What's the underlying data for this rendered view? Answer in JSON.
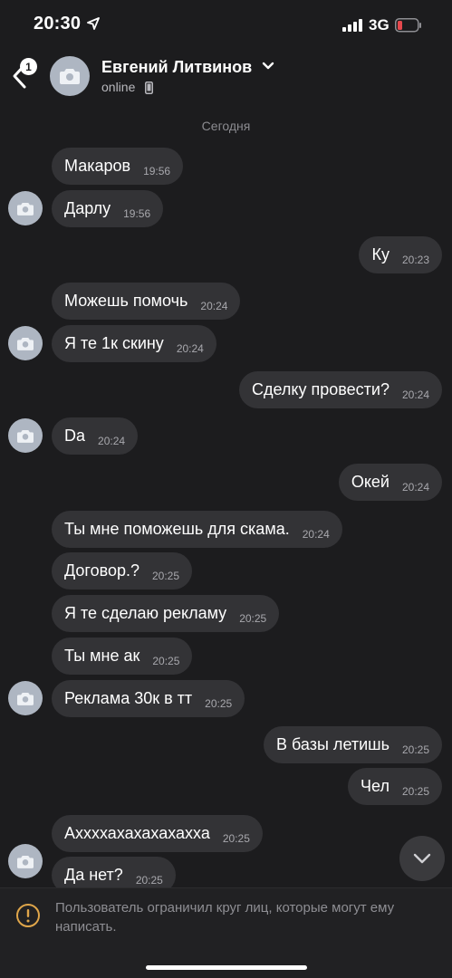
{
  "status_bar": {
    "time": "20:30",
    "network": "3G"
  },
  "header": {
    "back_badge": "1",
    "contact_name": "Евгений Литвинов",
    "status": "online"
  },
  "date_separator": "Сегодня",
  "messages": [
    {
      "text": "Макаров",
      "time": "19:56"
    },
    {
      "text": "Дарлу",
      "time": "19:56"
    },
    {
      "text": "Ку",
      "time": "20:23"
    },
    {
      "text": "Можешь помочь",
      "time": "20:24"
    },
    {
      "text": "Я те 1к скину",
      "time": "20:24"
    },
    {
      "text": "Сделку провести?",
      "time": "20:24"
    },
    {
      "text": "Da",
      "time": "20:24"
    },
    {
      "text": "Окей",
      "time": "20:24"
    },
    {
      "text": "Ты мне поможешь для скама.",
      "time": "20:24"
    },
    {
      "text": "Договор.?",
      "time": "20:25"
    },
    {
      "text": "Я те сделаю рекламу",
      "time": "20:25"
    },
    {
      "text": "Ты мне ак",
      "time": "20:25"
    },
    {
      "text": "Реклама 30к в тт",
      "time": "20:25"
    },
    {
      "text": "В базы летишь",
      "time": "20:25"
    },
    {
      "text": "Чел",
      "time": "20:25"
    },
    {
      "text": "Аххххахахахахахха",
      "time": "20:25"
    },
    {
      "text": "Да нет?",
      "time": "20:25"
    }
  ],
  "footer": {
    "notice": "Пользователь ограничил круг лиц, которые могут ему написать."
  },
  "colors": {
    "background": "#1c1c1e",
    "bubble": "#333336",
    "avatar": "#aeb6c2",
    "warning": "#e0a64a",
    "battery_low": "#e5484d"
  },
  "icons": [
    "back-icon",
    "location-arrow-icon",
    "signal-icon",
    "battery-icon",
    "camera-icon",
    "chevron-down-icon",
    "phone-icon",
    "warning-icon"
  ]
}
